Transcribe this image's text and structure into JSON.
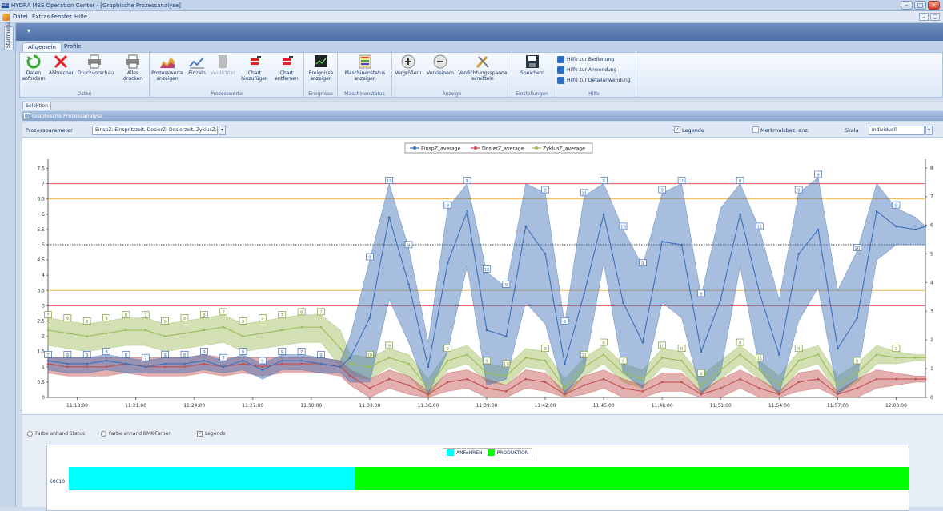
{
  "window": {
    "title": "HYDRA MES Operation Center - [Graphische Prozessanalyse]",
    "app_icon": "MES"
  },
  "menu": [
    "Datei",
    "Extras",
    "Fenster",
    "Hilfe"
  ],
  "side_tab": "Startmenü",
  "ribbon_tabs": [
    "Allgemein",
    "Profile"
  ],
  "ribbon": {
    "daten": {
      "label": "Daten",
      "buttons": [
        {
          "label": "Daten anfordern",
          "icon": "refresh-icon"
        },
        {
          "label": "Abbrechen",
          "icon": "cancel-icon"
        },
        {
          "label": "Druckvorschau",
          "icon": "printer-icon"
        },
        {
          "label": "Alles drucken",
          "icon": "printer-icon"
        }
      ]
    },
    "prozesswerte": {
      "label": "Prozesswerte",
      "buttons": [
        {
          "label": "Prozesswerte anzeigen",
          "icon": "area-chart-icon"
        },
        {
          "label": "Einzeln",
          "icon": "line-chart-icon"
        },
        {
          "label": "Verdichtet",
          "icon": "compress-icon"
        },
        {
          "label": "Chart hinzufügen",
          "icon": "chart-add-icon"
        },
        {
          "label": "Chart entfernen",
          "icon": "chart-remove-icon"
        }
      ]
    },
    "ereignisse": {
      "label": "Ereignisse",
      "buttons": [
        {
          "label": "Ereignisse anzeigen",
          "icon": "monitor-icon"
        }
      ]
    },
    "maschinenstatus": {
      "label": "Maschinenstatus",
      "buttons": [
        {
          "label": "Maschinenstatus anzeigen",
          "icon": "status-grid-icon"
        }
      ]
    },
    "anzeige": {
      "label": "Anzeige",
      "buttons": [
        {
          "label": "Vergrößern",
          "icon": "zoom-in-icon"
        },
        {
          "label": "Verkleinern",
          "icon": "zoom-out-icon"
        },
        {
          "label": "Verdichtungsspanne ermitteln",
          "icon": "tools-icon"
        }
      ]
    },
    "einstellungen": {
      "label": "Einstellungen",
      "buttons": [
        {
          "label": "Speichern",
          "icon": "save-icon"
        }
      ]
    },
    "hilfe": {
      "label": "Hilfe",
      "items": [
        "Hilfe zur Bedienung",
        "Hilfe zur Anwendung",
        "Hilfe zur Detailanwendung"
      ]
    }
  },
  "selektion_tab": "Selektion",
  "panel_title": "Graphische Prozessanalyse",
  "filter": {
    "label": "Prozessparameter",
    "value": "EinspZ: Einspritzzeit, DosierZ: Dosierzeit, ZyklusZ: ...",
    "legende_label": "Legende",
    "legende_checked": true,
    "merkmal_label": "Merkmalsbez. anz.",
    "skala_label": "Skala",
    "skala_value": "Individuell"
  },
  "chart_data": {
    "type": "line",
    "legend": [
      "EinspZ_average",
      "DosierZ_average",
      "ZyklusZ_average"
    ],
    "colors": {
      "EinspZ_average": "#3d6fb8",
      "DosierZ_average": "#c0504d",
      "ZyklusZ_average": "#9bbb59"
    },
    "x_ticks": [
      "11:18:00",
      "11:21:00",
      "11:24:00",
      "11:27:00",
      "11:30:00",
      "11:33:00",
      "11:36:00",
      "11:39:00",
      "11:42:00",
      "11:45:00",
      "11:48:00",
      "11:51:00",
      "11:54:00",
      "11:57:00",
      "12:00:00"
    ],
    "y_left_ticks": [
      "0",
      "0,5",
      "1",
      "1,5",
      "2",
      "2,5",
      "3",
      "3,5",
      "4",
      "4,5",
      "5",
      "5,5",
      "6",
      "6,5",
      "7",
      "7,5"
    ],
    "y_right_ticks": [
      "0",
      "1",
      "2",
      "3",
      "4",
      "5",
      "6",
      "7",
      "8"
    ],
    "ylim_left": [
      0,
      7.8
    ],
    "ylim_right": [
      0,
      8.3
    ],
    "x_minutes": [
      0,
      1,
      2,
      3,
      4,
      5,
      6,
      7,
      8,
      9,
      10,
      11,
      12,
      13,
      14,
      15,
      15.5,
      16.5,
      17.5,
      18.5,
      19.5,
      20.5,
      21.5,
      22.5,
      23.5,
      24.5,
      25.5,
      26.5,
      27.5,
      28.5,
      29.5,
      30.5,
      31.5,
      32.5,
      33.5,
      34.5,
      35.5,
      36.5,
      37.5,
      38.5,
      39.5,
      40.5,
      41.5,
      42.5,
      43.5,
      44.5,
      45
    ],
    "series": [
      {
        "name": "EinspZ_average",
        "values": [
          1.2,
          1.1,
          1.1,
          1.2,
          1.1,
          1.0,
          1.1,
          1.1,
          1.2,
          1.0,
          1.2,
          0.9,
          1.2,
          1.2,
          1.1,
          1.0,
          1.3,
          2.6,
          5.9,
          3.7,
          1.0,
          4.4,
          6.1,
          2.2,
          2.0,
          5.6,
          4.7,
          1.1,
          3.4,
          6.0,
          3.1,
          1.8,
          5.1,
          5.0,
          1.5,
          3.2,
          6.0,
          3.4,
          1.4,
          4.7,
          5.5,
          1.6,
          2.6,
          6.1,
          5.6,
          5.5,
          5.6
        ],
        "max": [
          1.3,
          1.3,
          1.3,
          1.4,
          1.3,
          1.2,
          1.3,
          1.3,
          1.4,
          1.2,
          1.4,
          1.1,
          1.4,
          1.4,
          1.3,
          1.2,
          2.0,
          4.5,
          7.0,
          4.9,
          1.8,
          6.2,
          7.0,
          4.1,
          3.6,
          7.0,
          6.7,
          2.4,
          6.6,
          7.0,
          5.5,
          4.3,
          6.7,
          7.0,
          3.3,
          6.2,
          7.0,
          5.5,
          3.2,
          6.7,
          7.2,
          3.5,
          4.8,
          7.0,
          6.2,
          5.9,
          5.6
        ],
        "min": [
          0.9,
          0.8,
          0.8,
          0.9,
          0.8,
          0.8,
          0.8,
          0.8,
          0.9,
          0.8,
          0.9,
          0.6,
          0.9,
          0.9,
          0.8,
          0.8,
          0.5,
          0.5,
          3.2,
          1.8,
          0.1,
          1.5,
          4.3,
          0.4,
          0.6,
          3.1,
          2.4,
          0.1,
          0.9,
          4.4,
          0.8,
          0.3,
          3.1,
          2.6,
          0.1,
          0.8,
          4.3,
          0.9,
          0.1,
          2.5,
          3.6,
          0.1,
          0.6,
          4.5,
          5.0,
          5.0,
          5.0
        ]
      },
      {
        "name": "DosierZ_average",
        "values": [
          1.1,
          1.0,
          1.0,
          1.0,
          1.1,
          1.0,
          1.0,
          1.0,
          1.1,
          1.0,
          1.1,
          1.0,
          1.1,
          1.1,
          1.1,
          1.0,
          0.7,
          0.3,
          0.6,
          0.4,
          0.1,
          0.5,
          0.6,
          0.3,
          0.2,
          0.6,
          0.5,
          0.1,
          0.4,
          0.6,
          0.3,
          0.2,
          0.5,
          0.5,
          0.1,
          0.3,
          0.6,
          0.3,
          0.1,
          0.5,
          0.6,
          0.1,
          0.3,
          0.6,
          0.6,
          0.6,
          0.6
        ],
        "max": [
          1.3,
          1.3,
          1.3,
          1.3,
          1.3,
          1.3,
          1.3,
          1.3,
          1.4,
          1.3,
          1.3,
          1.3,
          1.3,
          1.3,
          1.3,
          1.2,
          0.9,
          0.6,
          0.9,
          0.7,
          0.2,
          0.8,
          0.9,
          0.6,
          0.4,
          0.9,
          0.8,
          0.2,
          0.7,
          0.9,
          0.6,
          0.4,
          0.8,
          0.8,
          0.2,
          0.6,
          0.9,
          0.6,
          0.2,
          0.8,
          0.9,
          0.2,
          0.6,
          0.9,
          0.8,
          0.7,
          0.7
        ],
        "min": [
          0.8,
          0.7,
          0.7,
          0.7,
          0.8,
          0.7,
          0.7,
          0.7,
          0.8,
          0.7,
          0.8,
          0.7,
          0.8,
          0.8,
          0.8,
          0.7,
          0.4,
          0.0,
          0.3,
          0.1,
          0.0,
          0.2,
          0.3,
          0.0,
          0.0,
          0.3,
          0.2,
          0.0,
          0.1,
          0.3,
          0.0,
          0.0,
          0.2,
          0.2,
          0.0,
          0.0,
          0.3,
          0.0,
          0.0,
          0.2,
          0.3,
          0.0,
          0.0,
          0.3,
          0.4,
          0.5,
          0.5
        ]
      },
      {
        "name": "ZyklusZ_average",
        "values": [
          2.2,
          2.1,
          2.0,
          2.1,
          2.2,
          2.2,
          2.0,
          2.1,
          2.2,
          2.3,
          2.0,
          2.1,
          2.2,
          2.3,
          2.3,
          1.6,
          1.1,
          1.0,
          1.3,
          1.1,
          0.3,
          1.2,
          1.4,
          0.8,
          0.7,
          1.3,
          1.2,
          0.3,
          1.0,
          1.4,
          0.8,
          0.6,
          1.3,
          1.2,
          0.4,
          0.9,
          1.4,
          0.9,
          0.4,
          1.2,
          1.4,
          0.4,
          0.8,
          1.4,
          1.3,
          1.3,
          1.3
        ],
        "max": [
          2.6,
          2.5,
          2.4,
          2.5,
          2.6,
          2.6,
          2.4,
          2.5,
          2.6,
          2.7,
          2.4,
          2.5,
          2.6,
          2.7,
          2.7,
          2.2,
          1.4,
          1.3,
          1.6,
          1.4,
          0.6,
          1.5,
          1.7,
          1.1,
          1.0,
          1.6,
          1.5,
          0.6,
          1.3,
          1.7,
          1.1,
          0.9,
          1.6,
          1.5,
          0.7,
          1.2,
          1.7,
          1.2,
          0.7,
          1.5,
          1.7,
          0.7,
          1.1,
          1.7,
          1.5,
          1.4,
          1.4
        ],
        "min": [
          1.7,
          1.6,
          1.5,
          1.6,
          1.7,
          1.7,
          1.5,
          1.6,
          1.7,
          1.8,
          1.5,
          1.6,
          1.7,
          1.8,
          1.8,
          1.0,
          0.7,
          0.6,
          1.0,
          0.7,
          0.0,
          0.9,
          1.1,
          0.5,
          0.4,
          1.0,
          0.9,
          0.0,
          0.7,
          1.1,
          0.5,
          0.3,
          1.0,
          0.9,
          0.1,
          0.6,
          1.1,
          0.6,
          0.1,
          0.9,
          1.1,
          0.1,
          0.5,
          1.1,
          1.1,
          1.2,
          1.2
        ]
      }
    ],
    "reference_lines": [
      {
        "y": 7,
        "color": "#e85050"
      },
      {
        "y": 6.5,
        "color": "#f2b84b"
      },
      {
        "y": 5,
        "color": "#404040",
        "dotted": true
      },
      {
        "y": 3.5,
        "color": "#f2b84b"
      },
      {
        "y": 3,
        "color": "#e85050"
      }
    ],
    "data_labels": {
      "einsp": [
        [
          0,
          "7"
        ],
        [
          1,
          "9"
        ],
        [
          2,
          "9"
        ],
        [
          3,
          "8"
        ],
        [
          4,
          "8"
        ],
        [
          5,
          "7"
        ],
        [
          6,
          "9"
        ],
        [
          7,
          "8"
        ],
        [
          8,
          "9"
        ],
        [
          9,
          "7"
        ],
        [
          10,
          "8"
        ],
        [
          11,
          "9"
        ],
        [
          12,
          "9"
        ],
        [
          13,
          "7"
        ],
        [
          14,
          "9"
        ],
        [
          16.5,
          "9"
        ],
        [
          17.5,
          "10"
        ],
        [
          18.5,
          "9"
        ],
        [
          20.5,
          "9"
        ],
        [
          21.5,
          "9"
        ],
        [
          22.5,
          "10"
        ],
        [
          23.5,
          "9"
        ],
        [
          25.5,
          "9"
        ],
        [
          26.5,
          "8"
        ],
        [
          27.5,
          "11"
        ],
        [
          28.5,
          "9"
        ],
        [
          29.5,
          "10"
        ],
        [
          30.5,
          "9"
        ],
        [
          31.5,
          "9"
        ],
        [
          32.5,
          "10"
        ],
        [
          33.5,
          "9"
        ],
        [
          35.5,
          "8"
        ],
        [
          36.5,
          "11"
        ],
        [
          38.5,
          "9"
        ],
        [
          39.5,
          "9"
        ],
        [
          41.5,
          "10"
        ],
        [
          43.5,
          "9"
        ]
      ],
      "zyklus": [
        [
          0,
          "7"
        ],
        [
          1,
          "9"
        ],
        [
          2,
          "8"
        ],
        [
          3,
          "9"
        ],
        [
          4,
          "8"
        ],
        [
          5,
          "7"
        ],
        [
          6,
          "9"
        ],
        [
          7,
          "8"
        ],
        [
          8,
          "8"
        ],
        [
          9,
          "7"
        ],
        [
          10,
          "9"
        ],
        [
          11,
          "9"
        ],
        [
          12,
          "7"
        ],
        [
          13,
          "8"
        ],
        [
          14,
          "7"
        ],
        [
          16.5,
          "10"
        ],
        [
          17.5,
          "9"
        ],
        [
          20.5,
          "9"
        ],
        [
          22.5,
          "9"
        ],
        [
          23.5,
          "10"
        ],
        [
          25.5,
          "9"
        ],
        [
          27.5,
          "11"
        ],
        [
          28.5,
          "8"
        ],
        [
          29.5,
          "9"
        ],
        [
          31.5,
          "10"
        ],
        [
          32.5,
          "8"
        ],
        [
          33.5,
          "9"
        ],
        [
          35.5,
          "8"
        ],
        [
          36.5,
          "11"
        ],
        [
          38.5,
          "9"
        ],
        [
          41.5,
          "8"
        ],
        [
          43.5,
          "9"
        ]
      ]
    }
  },
  "bottom": {
    "radio1": "Farbe anhand Status",
    "radio2": "Farbe anhand BMK-Farben",
    "legende": "Legende",
    "legend_items": [
      {
        "label": "ANFAHREN",
        "color": "#00ffff"
      },
      {
        "label": "PRODUKTION",
        "color": "#00ff00"
      }
    ],
    "machine": "60610",
    "status_anfahren_fraction": 0.34
  }
}
